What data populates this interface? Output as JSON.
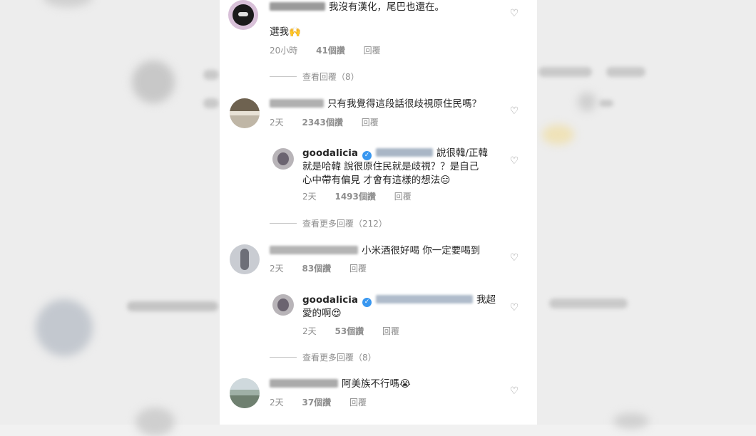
{
  "comments": [
    {
      "text": "我沒有漢化，尾巴也還在。",
      "text2": "選我🙌",
      "time": "20小時",
      "likes": "41個讚",
      "reply": "回覆",
      "view_replies": "查看回覆（8）"
    },
    {
      "text": "只有我覺得這段話很歧視原住民嗎？",
      "time": "2天",
      "likes": "2343個讚",
      "reply": "回覆"
    },
    {
      "username": "goodalicia",
      "text": "說很韓/正韓",
      "text2": "就是哈韓 說很原住民就是歧視？？是自己",
      "text3": "心中帶有偏見 才會有這樣的想法😑",
      "time": "2天",
      "likes": "1493個讚",
      "reply": "回覆",
      "view_replies": "查看更多回覆（212）"
    },
    {
      "text": "小米酒很好喝 你一定要喝到",
      "time": "2天",
      "likes": "83個讚",
      "reply": "回覆"
    },
    {
      "username": "goodalicia",
      "text": "我超",
      "text2": "愛的啊😍",
      "time": "2天",
      "likes": "53個讚",
      "reply": "回覆",
      "view_replies": "查看更多回覆（8）"
    },
    {
      "text": "阿美族不行嗎😭",
      "time": "2天",
      "likes": "37個讚",
      "reply": "回覆"
    }
  ],
  "icons": {
    "like": "heart-icon",
    "verified": "verified-badge-icon"
  },
  "colors": {
    "verified": "#3897f0",
    "meta": "#8e8e8e",
    "text": "#262626"
  }
}
